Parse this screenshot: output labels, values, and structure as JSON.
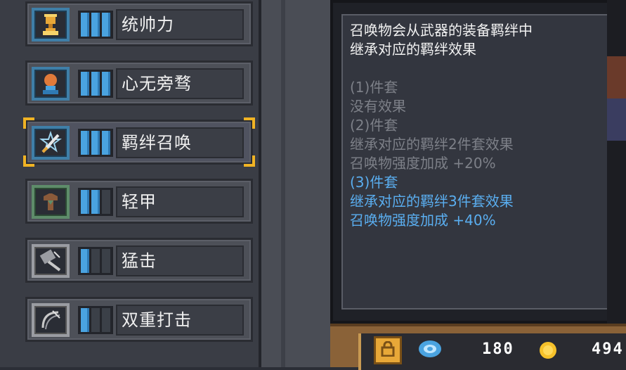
{
  "skills": [
    {
      "name": "统帅力",
      "icon": "trophy-icon",
      "frame": "blue",
      "level": 3
    },
    {
      "name": "心无旁骛",
      "icon": "focused-mind-icon",
      "frame": "blue",
      "level": 3
    },
    {
      "name": "羁绊召唤",
      "icon": "summon-sword-icon",
      "frame": "blue",
      "level": 3,
      "selected": true
    },
    {
      "name": "轻甲",
      "icon": "light-armor-icon",
      "frame": "green",
      "level": 2
    },
    {
      "name": "猛击",
      "icon": "hammer-icon",
      "frame": "gray",
      "level": 1
    },
    {
      "name": "双重打击",
      "icon": "double-strike-icon",
      "frame": "gray",
      "level": 1
    }
  ],
  "tooltip": {
    "description": [
      "召唤物会从武器的装备羁绊中",
      "继承对应的羁绊效果"
    ],
    "tiers": [
      {
        "header": "(1)件套",
        "lines": [
          "没有效果"
        ],
        "active": false
      },
      {
        "header": "(2)件套",
        "lines": [
          "继承对应的羁绊2件套效果",
          "召唤物强度加成 +20%"
        ],
        "active": false
      },
      {
        "header": "(3)件套",
        "lines": [
          "继承对应的羁绊3件套效果",
          "召唤物强度加成 +40%"
        ],
        "active": true
      }
    ]
  },
  "currency": {
    "gems": "180",
    "gold": "494"
  },
  "colors": {
    "active_text": "#5aaef0",
    "dim_text": "#7d8088",
    "selected_corner": "#f0b324",
    "level_bar_on": "#4aa3e0"
  }
}
